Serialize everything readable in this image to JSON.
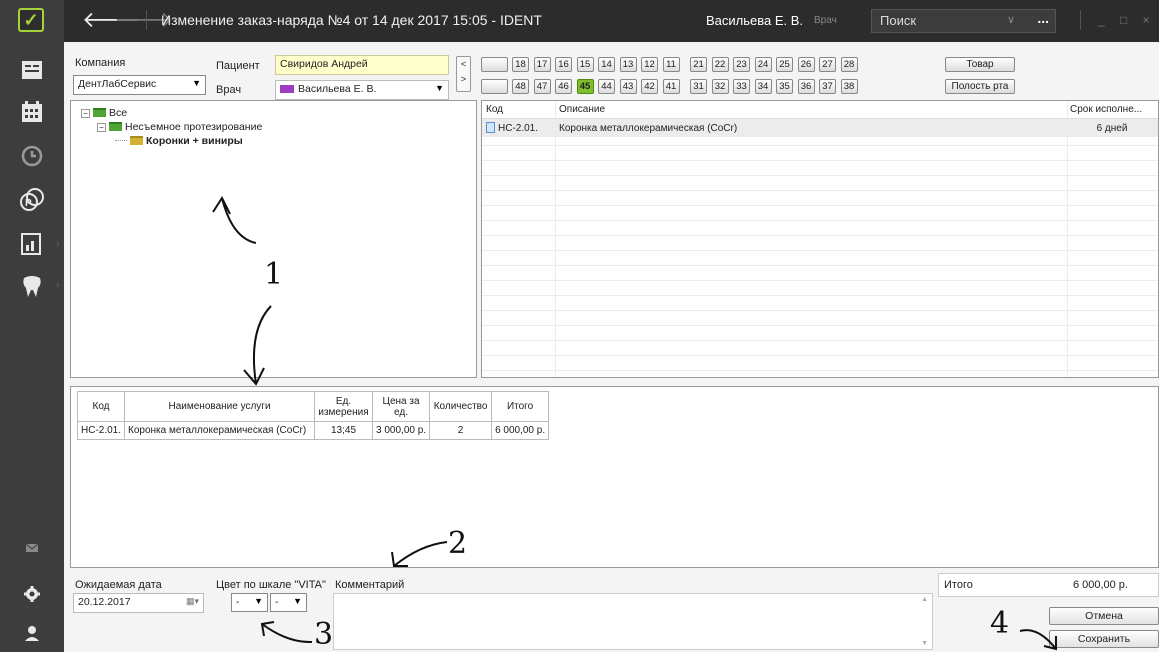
{
  "app": {
    "title": "Изменение заказ-наряда №4 от 14 дек 2017 15:05 - IDENT",
    "user_name": "Васильева Е. В.",
    "user_role": "Врач",
    "search_placeholder": "Поиск",
    "search_more": "...",
    "window_controls": "_ □ ×"
  },
  "form": {
    "company_label": "Компания",
    "company_value": "ДентЛабСервис",
    "patient_label": "Пациент",
    "patient_value": "Свиридов Андрей",
    "doctor_label": "Врач",
    "doctor_value": "Васильева Е. В.",
    "doctor_color": "#9b3fbf"
  },
  "teeth": {
    "upper": [
      "18",
      "17",
      "16",
      "15",
      "14",
      "13",
      "12",
      "11",
      "21",
      "22",
      "23",
      "24",
      "25",
      "26",
      "27",
      "28"
    ],
    "lower": [
      "48",
      "47",
      "46",
      "45",
      "44",
      "43",
      "42",
      "41",
      "31",
      "32",
      "33",
      "34",
      "35",
      "36",
      "37",
      "38"
    ],
    "selected": "45",
    "upper_button": "Товар",
    "lower_button": "Полость рта",
    "nav_prev": "<",
    "nav_next": ">"
  },
  "tree": {
    "root": "Все",
    "child": "Несъемное протезирование",
    "leaf": "Коронки + виниры"
  },
  "services": {
    "headers": [
      "Код",
      "Описание",
      "Срок исполне..."
    ],
    "rows": [
      {
        "code": "НС-2.01.",
        "description": "Коронка металлокерамическая (CoCr)",
        "term": "6 дней"
      }
    ]
  },
  "order": {
    "headers": [
      "Код",
      "Наименование услуги",
      "Ед. измерения",
      "Цена за ед.",
      "Количество",
      "Итого"
    ],
    "rows": [
      {
        "code": "НС-2.01.",
        "name": "Коронка металлокерамическая (CoCr)",
        "unit": "13;45",
        "price": "3 000,00 р.",
        "qty": "2",
        "total": "6 000,00 р."
      }
    ]
  },
  "footer": {
    "date_label": "Ожидаемая дата",
    "date_value": "20.12.2017",
    "vita_label": "Цвет по шкале \"VITA\"",
    "vita_a": "-",
    "vita_b": "-",
    "comment_label": "Комментарий",
    "total_label": "Итого",
    "total_value": "6 000,00 р.",
    "cancel_label": "Отмена",
    "save_label": "Сохранить"
  },
  "annotations": {
    "a1": "1",
    "a2": "2",
    "a3": "3",
    "a4": "4"
  }
}
